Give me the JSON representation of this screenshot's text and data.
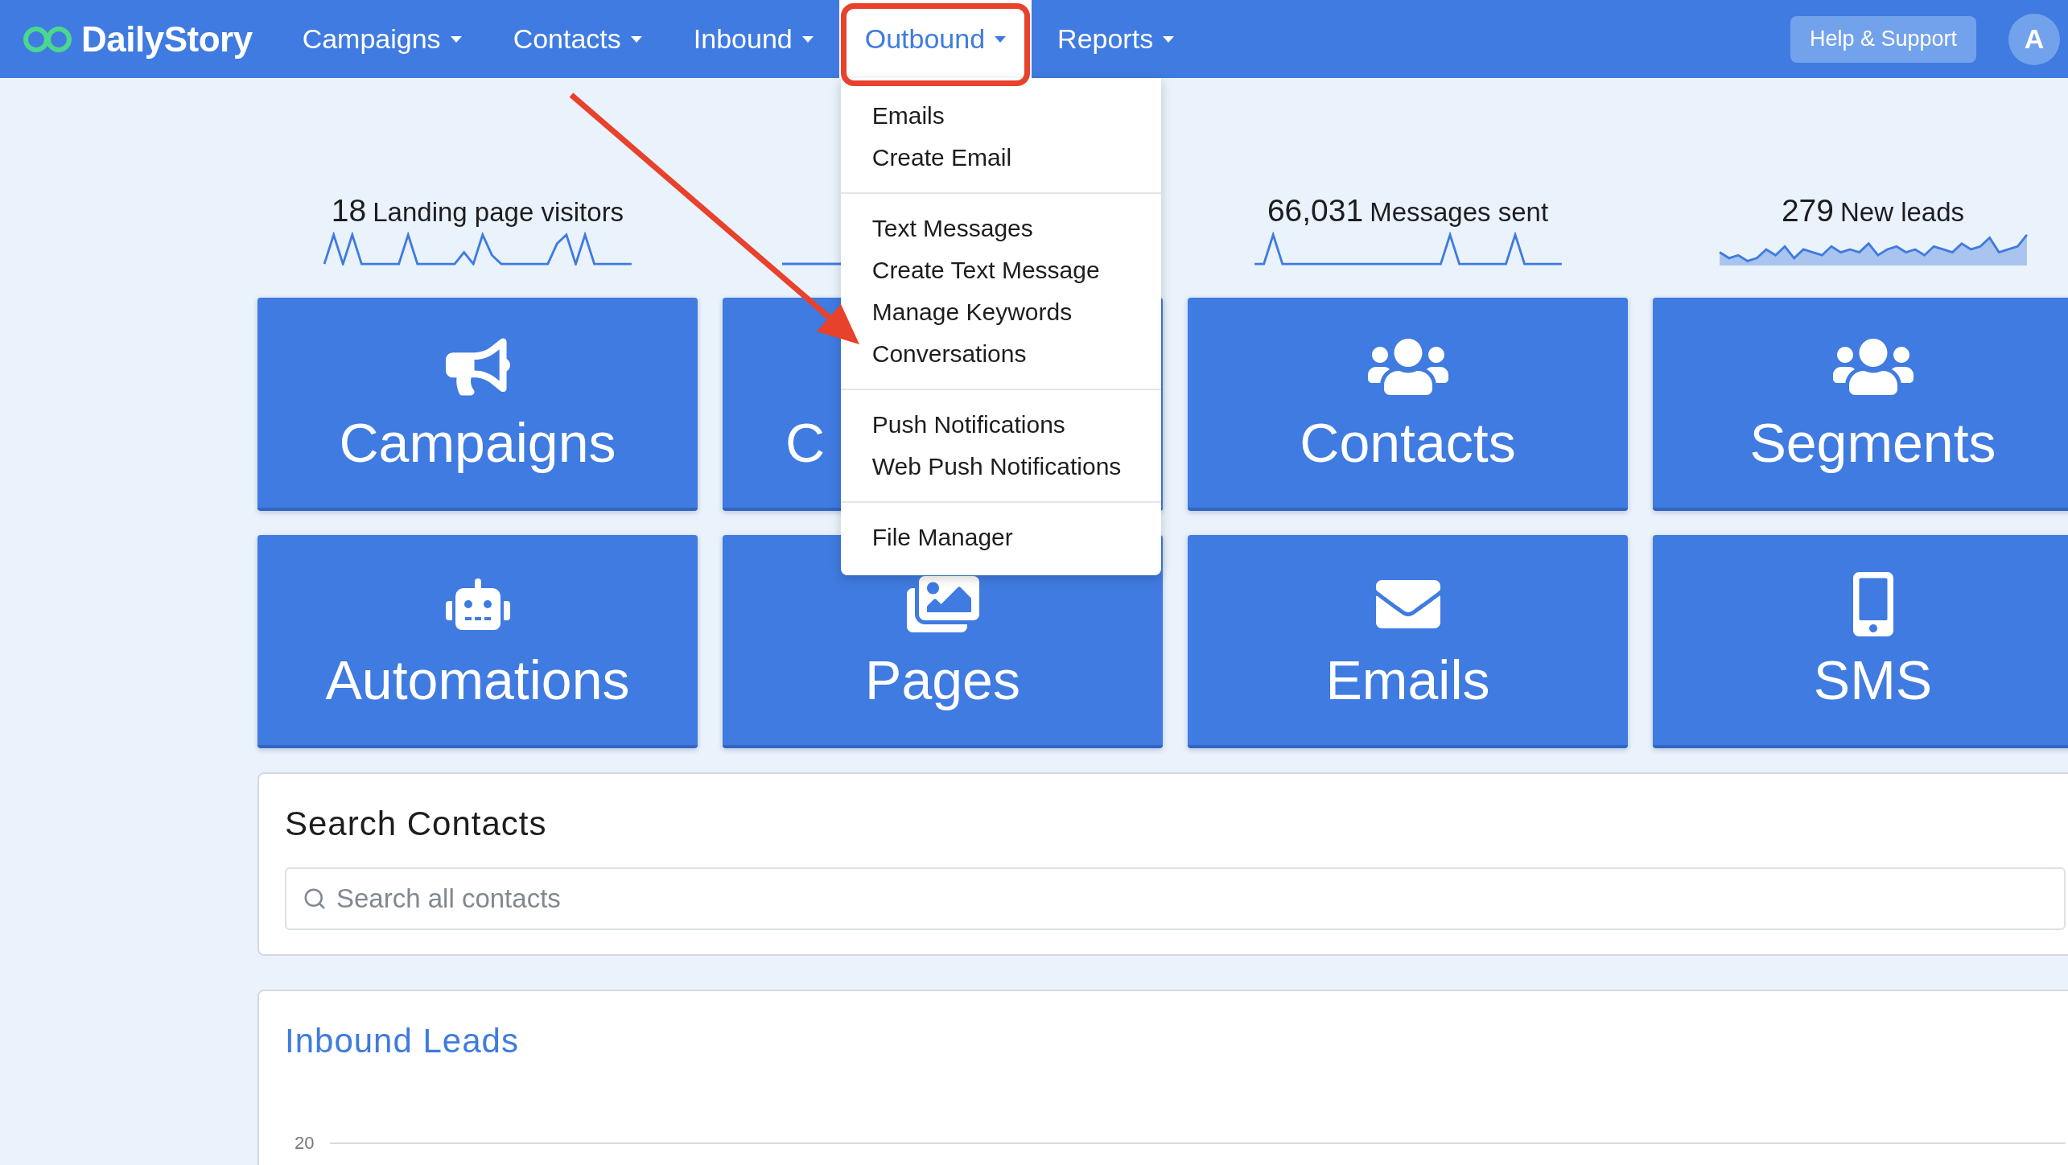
{
  "navbar": {
    "logo": "DailyStory",
    "items": [
      {
        "label": "Campaigns",
        "selected": false,
        "highlighted": false
      },
      {
        "label": "Contacts",
        "selected": false,
        "highlighted": false
      },
      {
        "label": "Inbound",
        "selected": false,
        "highlighted": false
      },
      {
        "label": "Outbound",
        "selected": true,
        "highlighted": true
      },
      {
        "label": "Reports",
        "selected": false,
        "highlighted": false
      }
    ],
    "help_button": "Help & Support",
    "avatar": "A"
  },
  "dropdown": {
    "groups": [
      [
        "Emails",
        "Create Email"
      ],
      [
        "Text Messages",
        "Create Text Message",
        "Manage Keywords",
        "Conversations"
      ],
      [
        "Push Notifications",
        "Web Push Notifications"
      ],
      [
        "File Manager"
      ]
    ]
  },
  "callout_arrow": true,
  "stats": [
    {
      "value": "18",
      "label": "Landing page visitors",
      "sparkline_filled": false
    },
    {
      "sparkline_filled": false
    },
    {
      "value": "66,031",
      "label": "Messages sent",
      "sparkline_filled": false
    },
    {
      "value": "279",
      "label": "New leads",
      "sparkline_filled": true
    }
  ],
  "tiles": [
    {
      "label": "Campaigns",
      "kind": "megaphone"
    },
    {
      "label": "C",
      "kind": "covered"
    },
    {
      "label": "Contacts",
      "kind": "group"
    },
    {
      "label": "Segments",
      "kind": "group"
    },
    {
      "label": "Automations",
      "kind": "robot"
    },
    {
      "label": "Pages",
      "kind": "images"
    },
    {
      "label": "Emails",
      "kind": "envelope"
    },
    {
      "label": "SMS",
      "kind": "phone"
    }
  ],
  "search_card": {
    "title": "Search Contacts",
    "placeholder": "Search all contacts"
  },
  "leads_card": {
    "title": "Inbound Leads",
    "axis_tick": "20"
  }
}
